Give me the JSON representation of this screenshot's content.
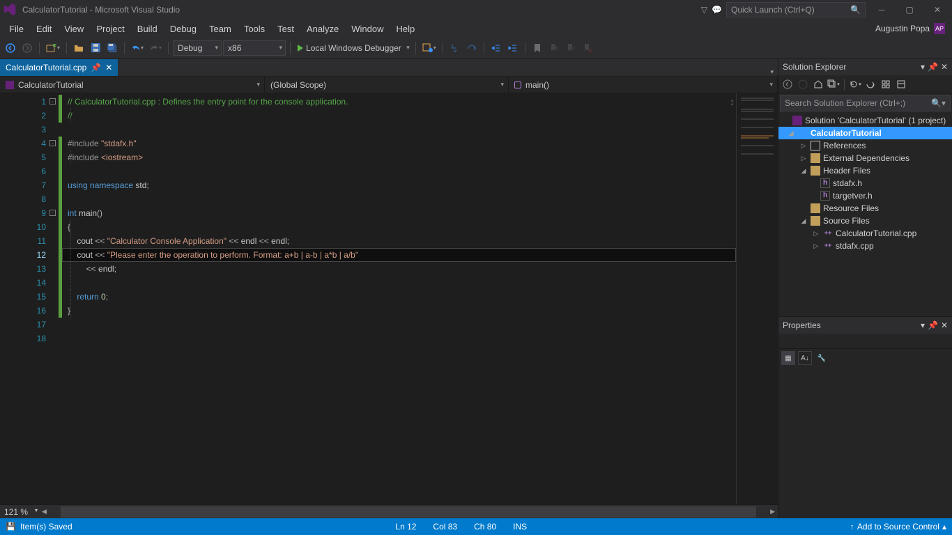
{
  "title": "CalculatorTutorial - Microsoft Visual Studio",
  "quick_launch_placeholder": "Quick Launch (Ctrl+Q)",
  "user": "Augustin Popa",
  "user_initials": "AP",
  "menu": [
    "File",
    "Edit",
    "View",
    "Project",
    "Build",
    "Debug",
    "Team",
    "Tools",
    "Test",
    "Analyze",
    "Window",
    "Help"
  ],
  "toolbar": {
    "config": "Debug",
    "platform": "x86",
    "start_label": "Local Windows Debugger"
  },
  "active_tab": "CalculatorTutorial.cpp",
  "nav": {
    "project": "CalculatorTutorial",
    "scope": "(Global Scope)",
    "member": "main()"
  },
  "code": {
    "lines": [
      {
        "n": 1,
        "fold": "-",
        "chg": "g",
        "tokens": [
          [
            "cm",
            "// CalculatorTutorial.cpp : Defines the entry point for the console application."
          ]
        ]
      },
      {
        "n": 2,
        "chg": "g",
        "ind": 1,
        "tokens": [
          [
            "cm",
            "//"
          ]
        ]
      },
      {
        "n": 3,
        "tokens": []
      },
      {
        "n": 4,
        "fold": "-",
        "chg": "g",
        "tokens": [
          [
            "inc",
            "#include "
          ],
          [
            "str",
            "\"stdafx.h\""
          ]
        ]
      },
      {
        "n": 5,
        "chg": "g",
        "ind": 1,
        "tokens": [
          [
            "inc",
            "#include "
          ],
          [
            "str",
            "<iostream>"
          ]
        ]
      },
      {
        "n": 6,
        "chg": "g",
        "tokens": []
      },
      {
        "n": 7,
        "chg": "g",
        "tokens": [
          [
            "kw",
            "using"
          ],
          [
            "id",
            " "
          ],
          [
            "kw",
            "namespace"
          ],
          [
            "id",
            " std"
          ],
          [
            "op",
            ";"
          ]
        ]
      },
      {
        "n": 8,
        "chg": "g",
        "tokens": []
      },
      {
        "n": 9,
        "fold": "-",
        "chg": "g",
        "tokens": [
          [
            "kw",
            "int"
          ],
          [
            "id",
            " main"
          ],
          [
            "op",
            "()"
          ]
        ]
      },
      {
        "n": 10,
        "chg": "g",
        "ind": 1,
        "tokens": [
          [
            "op",
            "{"
          ]
        ]
      },
      {
        "n": 11,
        "chg": "g",
        "ind": 1,
        "tokens": [
          [
            "id",
            "    cout "
          ],
          [
            "op",
            "<<"
          ],
          [
            "id",
            " "
          ],
          [
            "str",
            "\"Calculator Console Application\""
          ],
          [
            "id",
            " "
          ],
          [
            "op",
            "<<"
          ],
          [
            "id",
            " endl "
          ],
          [
            "op",
            "<<"
          ],
          [
            "id",
            " endl"
          ],
          [
            "op",
            ";"
          ]
        ]
      },
      {
        "n": 12,
        "chg": "g",
        "ind": 1,
        "hl": true,
        "tokens": [
          [
            "id",
            "    cout "
          ],
          [
            "op",
            "<<"
          ],
          [
            "id",
            " "
          ],
          [
            "str",
            "\"Please enter the operation to perform. Format: a+b | a-b | a*b | a/b\""
          ]
        ]
      },
      {
        "n": 13,
        "chg": "g",
        "ind": 1,
        "tokens": [
          [
            "id",
            "        "
          ],
          [
            "op",
            "<<"
          ],
          [
            "id",
            " endl"
          ],
          [
            "op",
            ";"
          ]
        ]
      },
      {
        "n": 14,
        "chg": "g",
        "ind": 1,
        "tokens": []
      },
      {
        "n": 15,
        "chg": "g",
        "ind": 1,
        "tokens": [
          [
            "id",
            "    "
          ],
          [
            "kw",
            "return"
          ],
          [
            "id",
            " "
          ],
          [
            "num",
            "0"
          ],
          [
            "op",
            ";"
          ]
        ]
      },
      {
        "n": 16,
        "chg": "g",
        "ind": 1,
        "tokens": [
          [
            "op",
            "}"
          ]
        ]
      },
      {
        "n": 17,
        "tokens": []
      },
      {
        "n": 18,
        "tokens": []
      }
    ],
    "current_line": 12
  },
  "zoom": "121 %",
  "solution_explorer": {
    "title": "Solution Explorer",
    "search_placeholder": "Search Solution Explorer (Ctrl+;)",
    "solution": "Solution 'CalculatorTutorial' (1 project)",
    "project": "CalculatorTutorial",
    "nodes": {
      "references": "References",
      "external": "External Dependencies",
      "header_files": "Header Files",
      "stdafx_h": "stdafx.h",
      "targetver_h": "targetver.h",
      "resource_files": "Resource Files",
      "source_files": "Source Files",
      "calc_cpp": "CalculatorTutorial.cpp",
      "stdafx_cpp": "stdafx.cpp"
    }
  },
  "properties": {
    "title": "Properties"
  },
  "status": {
    "saved": "Item(s) Saved",
    "ln": "Ln 12",
    "col": "Col 83",
    "ch": "Ch 80",
    "ins": "INS",
    "src_ctrl": "Add to Source Control"
  }
}
